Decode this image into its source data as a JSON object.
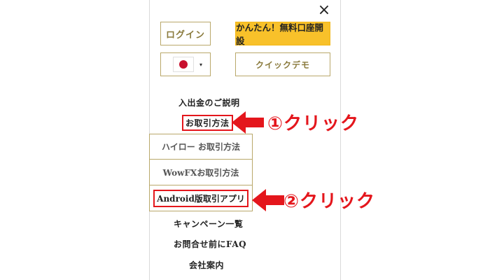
{
  "header": {
    "close_icon": "×"
  },
  "buttons": {
    "login": "ログイン",
    "signup": "かんたん！無料口座開設",
    "demo": "クイックデモ",
    "language_selector": {
      "flag": "japan-flag-icon",
      "caret": "▾"
    }
  },
  "menu": {
    "deposit": "入出金のご説明",
    "trading": "お取引方法",
    "submenu": [
      "ハイロー お取引方法",
      "WowFXお取引方法",
      "Android版取引アプリ"
    ],
    "campaign": "キャンペーン一覧",
    "faq": "お問合せ前にFAQ",
    "company": "会社案内"
  },
  "annotations": {
    "step1": "①クリック",
    "step2": "②クリック",
    "color": "#e4161c"
  },
  "colors": {
    "accent_gold": "#b9a86a",
    "signup_yellow": "#f8c12a",
    "highlight_red": "#e4161c"
  }
}
